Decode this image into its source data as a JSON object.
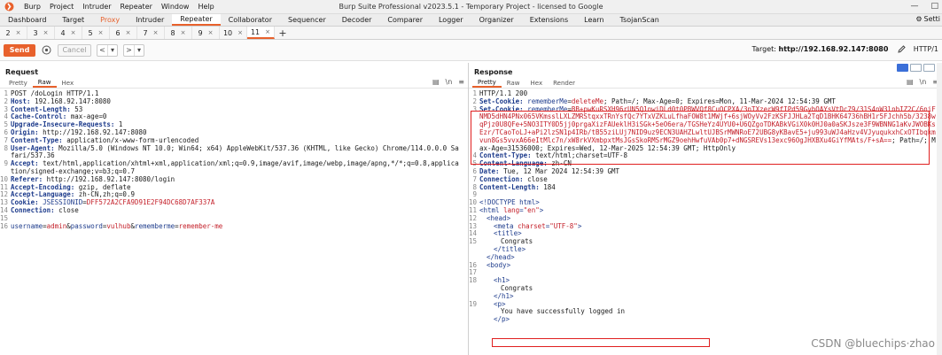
{
  "window": {
    "title": "Burp Suite Professional v2023.5.1 - Temporary Project - licensed to Google",
    "menu": [
      "Burp",
      "Project",
      "Intruder",
      "Repeater",
      "Window",
      "Help"
    ]
  },
  "tool_tabs": {
    "items": [
      "Dashboard",
      "Target",
      "Proxy",
      "Intruder",
      "Repeater",
      "Collaborator",
      "Sequencer",
      "Decoder",
      "Comparer",
      "Logger",
      "Organizer",
      "Extensions",
      "Learn",
      "TsojanScan"
    ],
    "active_index": 4,
    "highlighted_index": 2,
    "settings_label": "Setti"
  },
  "repeater_tabs": {
    "items": [
      "2",
      "3",
      "4",
      "5",
      "6",
      "7",
      "8",
      "9",
      "10",
      "11"
    ],
    "active_index": 9,
    "add_label": "+"
  },
  "actions": {
    "send_label": "Send",
    "cancel_label": "Cancel",
    "target_prefix": "Target:",
    "target_value": "http://192.168.92.147:8080",
    "http_version": "HTTP/1"
  },
  "request": {
    "title": "Request",
    "tabs": [
      "Pretty",
      "Raw",
      "Hex"
    ],
    "active_tab": 1,
    "lines": [
      {
        "n": "1",
        "parts": [
          [
            "",
            "POST /doLogin HTTP/1.1"
          ]
        ]
      },
      {
        "n": "2",
        "parts": [
          [
            "hk",
            "Host:"
          ],
          [
            "",
            " 192.168.92.147:8080"
          ]
        ]
      },
      {
        "n": "3",
        "parts": [
          [
            "hk",
            "Content-Length:"
          ],
          [
            "",
            " 53"
          ]
        ]
      },
      {
        "n": "4",
        "parts": [
          [
            "hk",
            "Cache-Control:"
          ],
          [
            "",
            " max-age=0"
          ]
        ]
      },
      {
        "n": "5",
        "parts": [
          [
            "hk",
            "Upgrade-Insecure-Requests:"
          ],
          [
            "",
            " 1"
          ]
        ]
      },
      {
        "n": "6",
        "parts": [
          [
            "hk",
            "Origin:"
          ],
          [
            "",
            " http://192.168.92.147:8080"
          ]
        ]
      },
      {
        "n": "7",
        "parts": [
          [
            "hk",
            "Content-Type:"
          ],
          [
            "",
            " application/x-www-form-urlencoded"
          ]
        ]
      },
      {
        "n": "8",
        "parts": [
          [
            "hk",
            "User-Agent:"
          ],
          [
            "",
            " Mozilla/5.0 (Windows NT 10.0; Win64; x64) AppleWebKit/537.36 (KHTML, like Gecko) Chrome/114.0.0.0 Safari/537.36"
          ]
        ]
      },
      {
        "n": "9",
        "parts": [
          [
            "hk",
            "Accept:"
          ],
          [
            "",
            " text/html,application/xhtml+xml,application/xml;q=0.9,image/avif,image/webp,image/apng,*/*;q=0.8,application/signed-exchange;v=b3;q=0.7"
          ]
        ]
      },
      {
        "n": "10",
        "parts": [
          [
            "hk",
            "Referer:"
          ],
          [
            "",
            " http://192.168.92.147:8080/login"
          ]
        ]
      },
      {
        "n": "11",
        "parts": [
          [
            "hk",
            "Accept-Encoding:"
          ],
          [
            "",
            " gzip, deflate"
          ]
        ]
      },
      {
        "n": "12",
        "parts": [
          [
            "hk",
            "Accept-Language:"
          ],
          [
            "",
            " zh-CN,zh;q=0.9"
          ]
        ]
      },
      {
        "n": "13",
        "parts": [
          [
            "hk",
            "Cookie:"
          ],
          [
            "pn",
            " JSESSIONID"
          ],
          [
            "",
            "="
          ],
          [
            "pv",
            "DFF572A2CFA9D91E2F94DC68D7AF337A"
          ]
        ]
      },
      {
        "n": "14",
        "parts": [
          [
            "hk",
            "Connection:"
          ],
          [
            "",
            " close"
          ]
        ]
      },
      {
        "n": "15",
        "parts": [
          [
            "",
            " "
          ]
        ]
      },
      {
        "n": "16",
        "parts": [
          [
            "pn",
            "username"
          ],
          [
            "",
            "="
          ],
          [
            "pv",
            "admin"
          ],
          [
            "",
            "&"
          ],
          [
            "pn",
            "password"
          ],
          [
            "",
            "="
          ],
          [
            "pv",
            "vulhub"
          ],
          [
            "",
            "&"
          ],
          [
            "pn",
            "rememberme"
          ],
          [
            "",
            "="
          ],
          [
            "pv",
            "remember-me"
          ]
        ]
      }
    ]
  },
  "response": {
    "title": "Response",
    "tabs": [
      "Pretty",
      "Raw",
      "Hex",
      "Render"
    ],
    "active_tab": 0,
    "lines": [
      {
        "n": "1",
        "parts": [
          [
            "",
            "HTTP/1.1 200"
          ]
        ]
      },
      {
        "n": "2",
        "parts": [
          [
            "hk",
            "Set-Cookie:"
          ],
          [
            "pn",
            " rememberMe"
          ],
          [
            "",
            "="
          ],
          [
            "pv",
            "deleteMe"
          ],
          [
            "",
            "; Path=/; Max-Age=0; Expires=Mon, 11-Mar-2024 12:54:39 GMT"
          ]
        ]
      },
      {
        "n": "3",
        "parts": [
          [
            "hk",
            "Set-Cookie:"
          ],
          [
            "pn",
            " rememberMe"
          ],
          [
            "",
            "="
          ],
          [
            "pv",
            "BB+pwKuRSXH96rUN5Q1nwiDLd0t0PBWVQf8CuOCPXA/3nTXzerW9fIPd59GybOAYsVtDc79/31S4nW3lnbIZ2C/6niFNMD5dHN4PNx065VKmsslLXLZMRStqxxTRnYsfQc7YTxVZKLuLfhaFOW8t1MWjf+6sjWOyVv2FzKSFJJHLa2TqD1BHK64736hBH1r5FJchh5b/3238wqPjz0U8QFe+5NO3ITY0D5jj0prgaXizFAUeklH3iSGk+5eO6era/TGSHeYz4UYU0+U6QZgoTDKABkVGiX0k0HJ0a0aSKJsze3F9WBNNG1aKvJWOBKsEzr/TCaoToLJ+aPi2lzSN1p4IRb/tB55ziLUj7NID9uz9ECN3UAHZLwltUJBSrMWNRoE72UBG8yKBavE5+ju993uWJ4aHzv4VJyuqukxhCxOTIbqkmvun8Gs5vvxA66eItMlc7n/xW8rkVXmbpxtMsJGsSkoRMSrMGZ9oehHwfuVAb0p7+dNGSREVs13exc96OgJHXBXu4GiYfMAts/F+sA=="
          ],
          [
            "",
            "; Path=/; Max-Age=31536000; Expires=Wed, 12-Mar-2025 12:54:39 GMT; HttpOnly"
          ]
        ]
      },
      {
        "n": "4",
        "parts": [
          [
            "hk",
            "Content-Type:"
          ],
          [
            "",
            " text/html;charset=UTF-8"
          ]
        ]
      },
      {
        "n": "5",
        "parts": [
          [
            "hk",
            "Content-Language:"
          ],
          [
            "",
            " zh-CN"
          ]
        ]
      },
      {
        "n": "6",
        "parts": [
          [
            "hk",
            "Date:"
          ],
          [
            "",
            " Tue, 12 Mar 2024 12:54:39 GMT"
          ]
        ]
      },
      {
        "n": "7",
        "parts": [
          [
            "hk",
            "Connection:"
          ],
          [
            "",
            " close"
          ]
        ]
      },
      {
        "n": "8",
        "parts": [
          [
            "hk",
            "Content-Length:"
          ],
          [
            "",
            " 184"
          ]
        ]
      },
      {
        "n": "9",
        "parts": [
          [
            "",
            " "
          ]
        ]
      },
      {
        "n": "10",
        "parts": [
          [
            "tag",
            "<!DOCTYPE html>"
          ]
        ]
      },
      {
        "n": "11",
        "parts": [
          [
            "tag",
            "<html "
          ],
          [
            "attr",
            "lang"
          ],
          [
            "tag",
            "="
          ],
          [
            "attr",
            "\"en\""
          ],
          [
            "tag",
            ">"
          ]
        ]
      },
      {
        "n": "12",
        "ind": 1,
        "parts": [
          [
            "tag",
            "<head>"
          ]
        ]
      },
      {
        "n": "13",
        "ind": 2,
        "parts": [
          [
            "tag",
            "<meta "
          ],
          [
            "attr",
            "charset"
          ],
          [
            "tag",
            "="
          ],
          [
            "attr",
            "\"UTF-8\""
          ],
          [
            "tag",
            ">"
          ]
        ]
      },
      {
        "n": "14",
        "ind": 2,
        "parts": [
          [
            "tag",
            "<title>"
          ]
        ]
      },
      {
        "n": "15",
        "ind": 3,
        "parts": [
          [
            "",
            "Congrats"
          ]
        ]
      },
      {
        "n": "",
        "ind": 2,
        "parts": [
          [
            "tag",
            "</title>"
          ]
        ]
      },
      {
        "n": "",
        "ind": 1,
        "parts": [
          [
            "tag",
            "</head>"
          ]
        ]
      },
      {
        "n": "16",
        "ind": 1,
        "parts": [
          [
            "tag",
            "<body>"
          ]
        ]
      },
      {
        "n": "17",
        "parts": [
          [
            "",
            " "
          ]
        ]
      },
      {
        "n": "18",
        "ind": 2,
        "parts": [
          [
            "tag",
            "<h1>"
          ]
        ]
      },
      {
        "n": "",
        "ind": 3,
        "parts": [
          [
            "",
            "Congrats"
          ]
        ]
      },
      {
        "n": "",
        "ind": 2,
        "parts": [
          [
            "tag",
            "</h1>"
          ]
        ]
      },
      {
        "n": "19",
        "ind": 2,
        "parts": [
          [
            "tag",
            "<p>"
          ]
        ]
      },
      {
        "n": "",
        "ind": 3,
        "parts": [
          [
            "",
            "You have successfully logged in"
          ]
        ]
      },
      {
        "n": "",
        "ind": 2,
        "parts": [
          [
            "tag",
            "</p>"
          ]
        ]
      }
    ]
  },
  "watermark": "CSDN @bluechips·zhao",
  "colors": {
    "accent": "#e8612c",
    "header_key": "#1e3c8c",
    "param_value": "#c4202a",
    "highlight_box": "#e02020"
  }
}
